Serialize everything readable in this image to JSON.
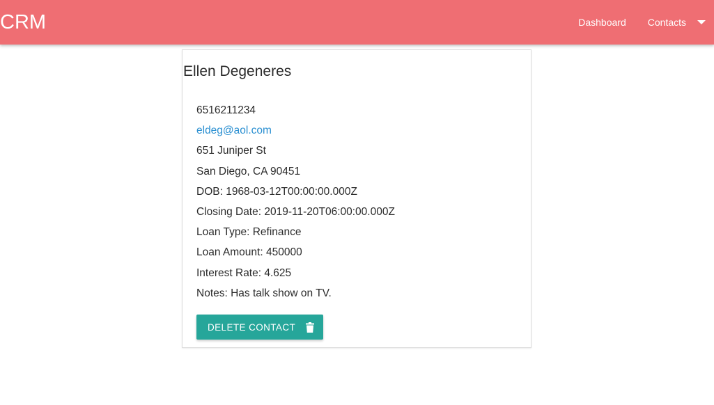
{
  "header": {
    "brand": "CRM",
    "nav": [
      {
        "label": "Dashboard"
      },
      {
        "label": "Contacts"
      }
    ],
    "dropdown_icon": "arrow-drop-down-icon"
  },
  "contact": {
    "name": "Ellen Degeneres",
    "phone": "6516211234",
    "email": "eldeg@aol.com",
    "street": "651 Juniper St",
    "city_state_zip": "San Diego, CA 90451",
    "dob": "DOB: 1968-03-12T00:00:00.000Z",
    "closing_date": "Closing Date: 2019-11-20T06:00:00.000Z",
    "loan_type": "Loan Type: Refinance",
    "loan_amount": "Loan Amount: 450000",
    "interest_rate": "Interest Rate: 4.625",
    "notes": "Notes: Has talk show on TV."
  },
  "actions": {
    "delete_label": "DELETE CONTACT",
    "delete_icon": "trash-icon"
  },
  "colors": {
    "navbar": "#ef6e73",
    "button": "#26a69a",
    "link": "#2a8fd1"
  }
}
